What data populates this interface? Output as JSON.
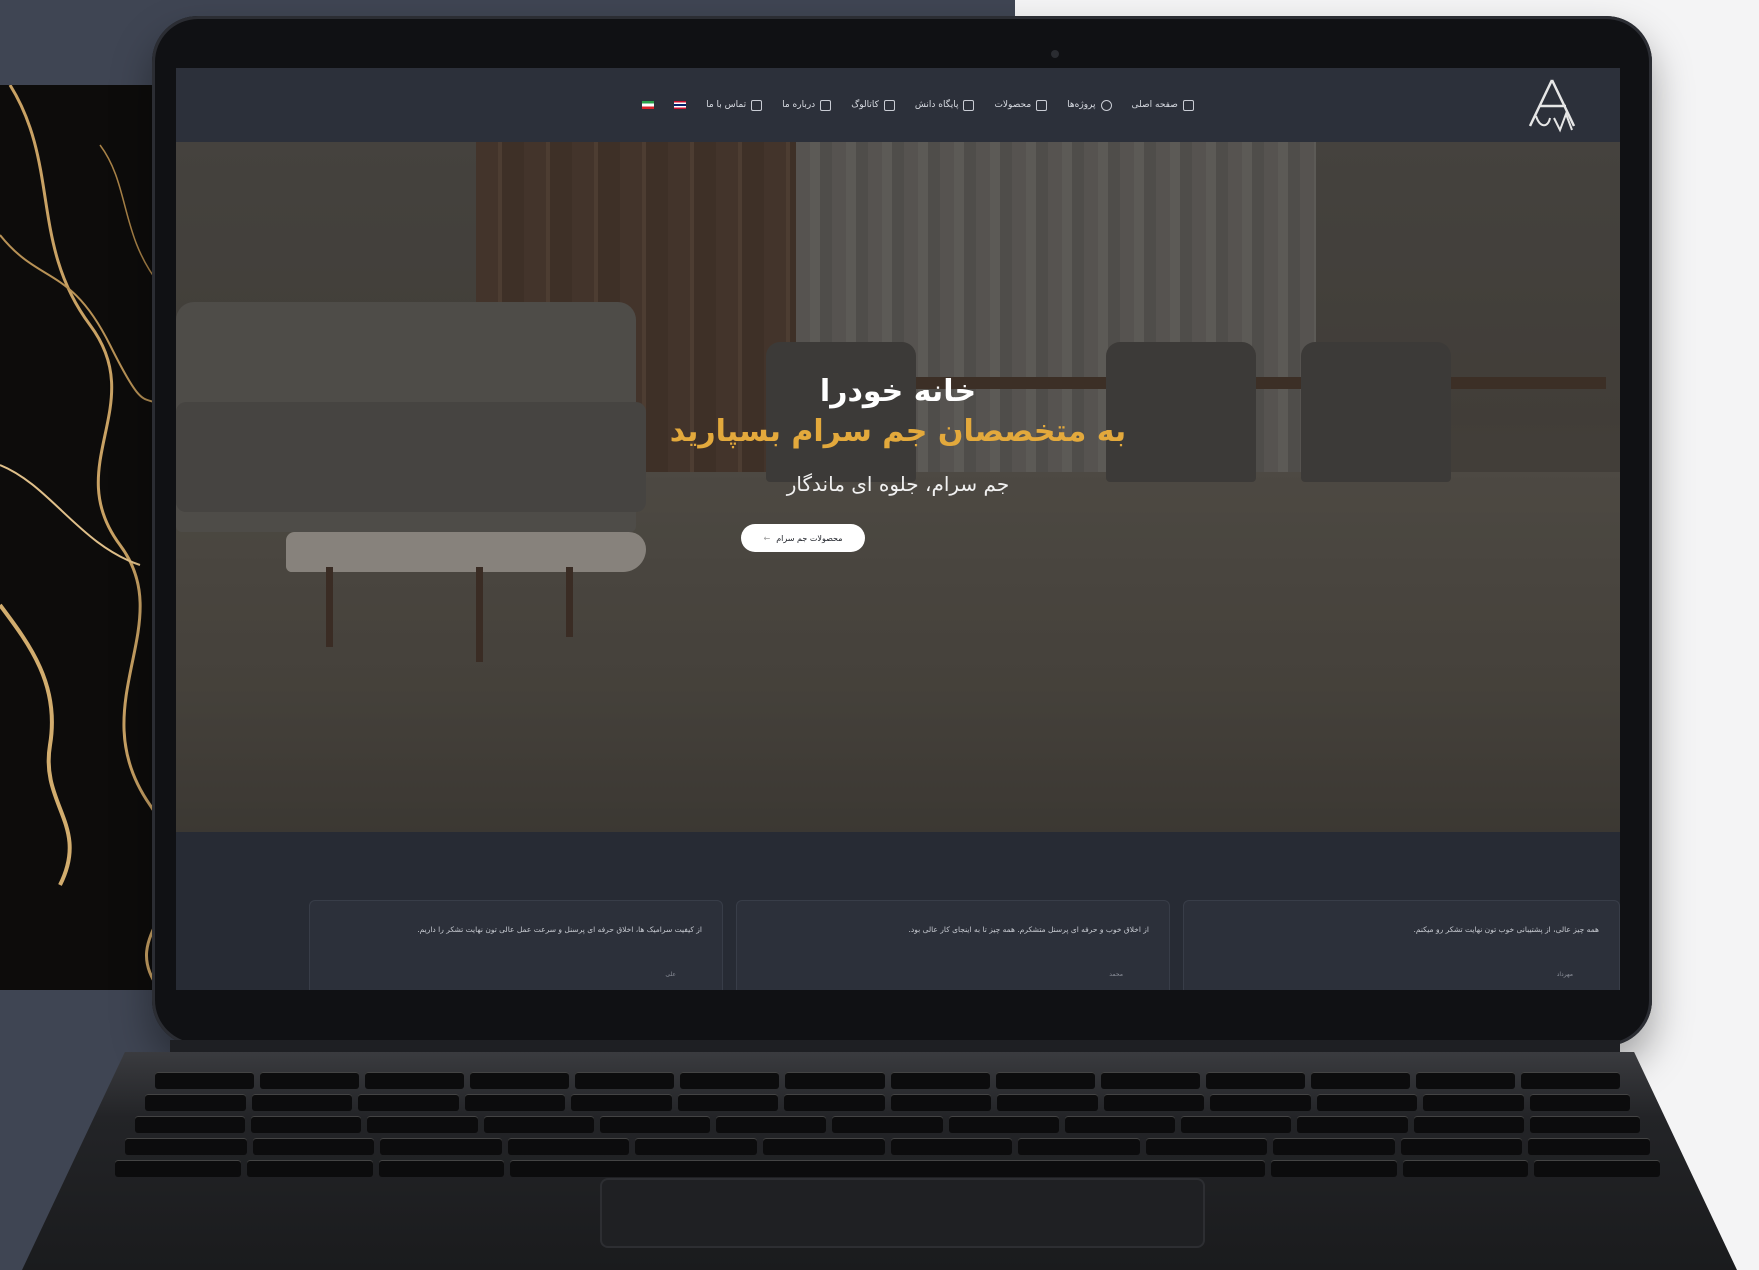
{
  "site": {
    "logo_text": "JAM",
    "nav": [
      {
        "label": "صفحه اصلی",
        "icon": "home-icon"
      },
      {
        "label": "پروژه‌ها",
        "icon": "gear-icon"
      },
      {
        "label": "محصولات",
        "icon": "box-icon"
      },
      {
        "label": "پایگاه دانش",
        "icon": "book-icon"
      },
      {
        "label": "کاتالوگ",
        "icon": "file-icon"
      },
      {
        "label": "درباره ما",
        "icon": "info-icon"
      },
      {
        "label": "تماس با ما",
        "icon": "phone-icon"
      }
    ],
    "languages": [
      "fa",
      "en"
    ]
  },
  "hero": {
    "title_line1": "خانه خودرا",
    "title_line2": "به متخصصان جم سرام بسپارید",
    "subtitle": "جم سرام، جلوه ای ماندگار",
    "button_label": "محصولات جم سرام",
    "button_arrow": "←"
  },
  "testimonials": [
    {
      "text": "همه چیز عالی، از پشتیبانی خوب تون نهایت تشکر رو میکنم.",
      "name": "مهرداد"
    },
    {
      "text": "از اخلاق خوب و حرفه ای پرسنل متشکرم. همه چیز تا به اینجای کار عالی بود.",
      "name": "محمد"
    },
    {
      "text": "از کیفیت سرامیک ها، اخلاق حرفه ای پرسنل و سرعت عمل عالی تون نهایت تشکر را داریم.",
      "name": "علی"
    }
  ],
  "colors": {
    "accent_gold": "#e3a93c",
    "header_bg": "#2c303a",
    "section_bg": "#272b34"
  }
}
